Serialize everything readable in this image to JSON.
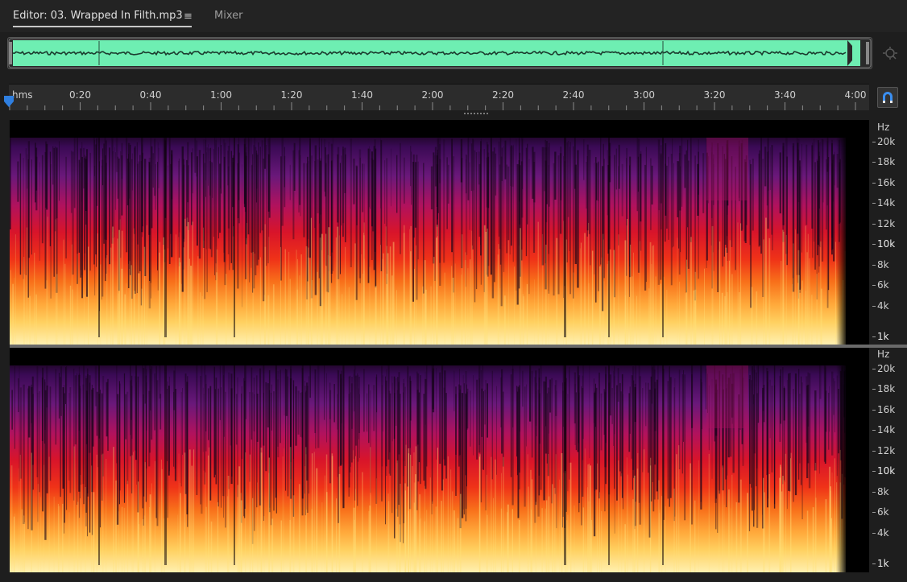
{
  "tabs": {
    "editor_label": "Editor: 03. Wrapped In Filth.mp3",
    "menu_glyph": "≡",
    "mixer_label": "Mixer"
  },
  "overview": {
    "waveform_color": "#6eeeb2",
    "icon": "zoom-navigator-icon"
  },
  "ruler": {
    "unit": "hms",
    "labels": [
      "0:20",
      "0:40",
      "1:00",
      "1:20",
      "1:40",
      "2:00",
      "2:20",
      "2:40",
      "3:00",
      "3:20",
      "3:40",
      "4:00"
    ],
    "duration_seconds": 240
  },
  "spectral": {
    "unit": "Hz",
    "channels": [
      {
        "labels": [
          "20k",
          "18k",
          "16k",
          "14k",
          "12k",
          "10k",
          "8k",
          "6k",
          "4k",
          "1k"
        ]
      },
      {
        "labels": [
          "20k",
          "18k",
          "16k",
          "14k",
          "12k",
          "10k",
          "8k",
          "6k",
          "4k",
          "1k"
        ]
      }
    ],
    "palette": [
      "#000000",
      "#3a0a55",
      "#7a1a8a",
      "#b0125e",
      "#e0161e",
      "#f8701a",
      "#ffc84a",
      "#fff0b0"
    ]
  },
  "controls": {
    "snap_icon": "magnet-icon"
  }
}
